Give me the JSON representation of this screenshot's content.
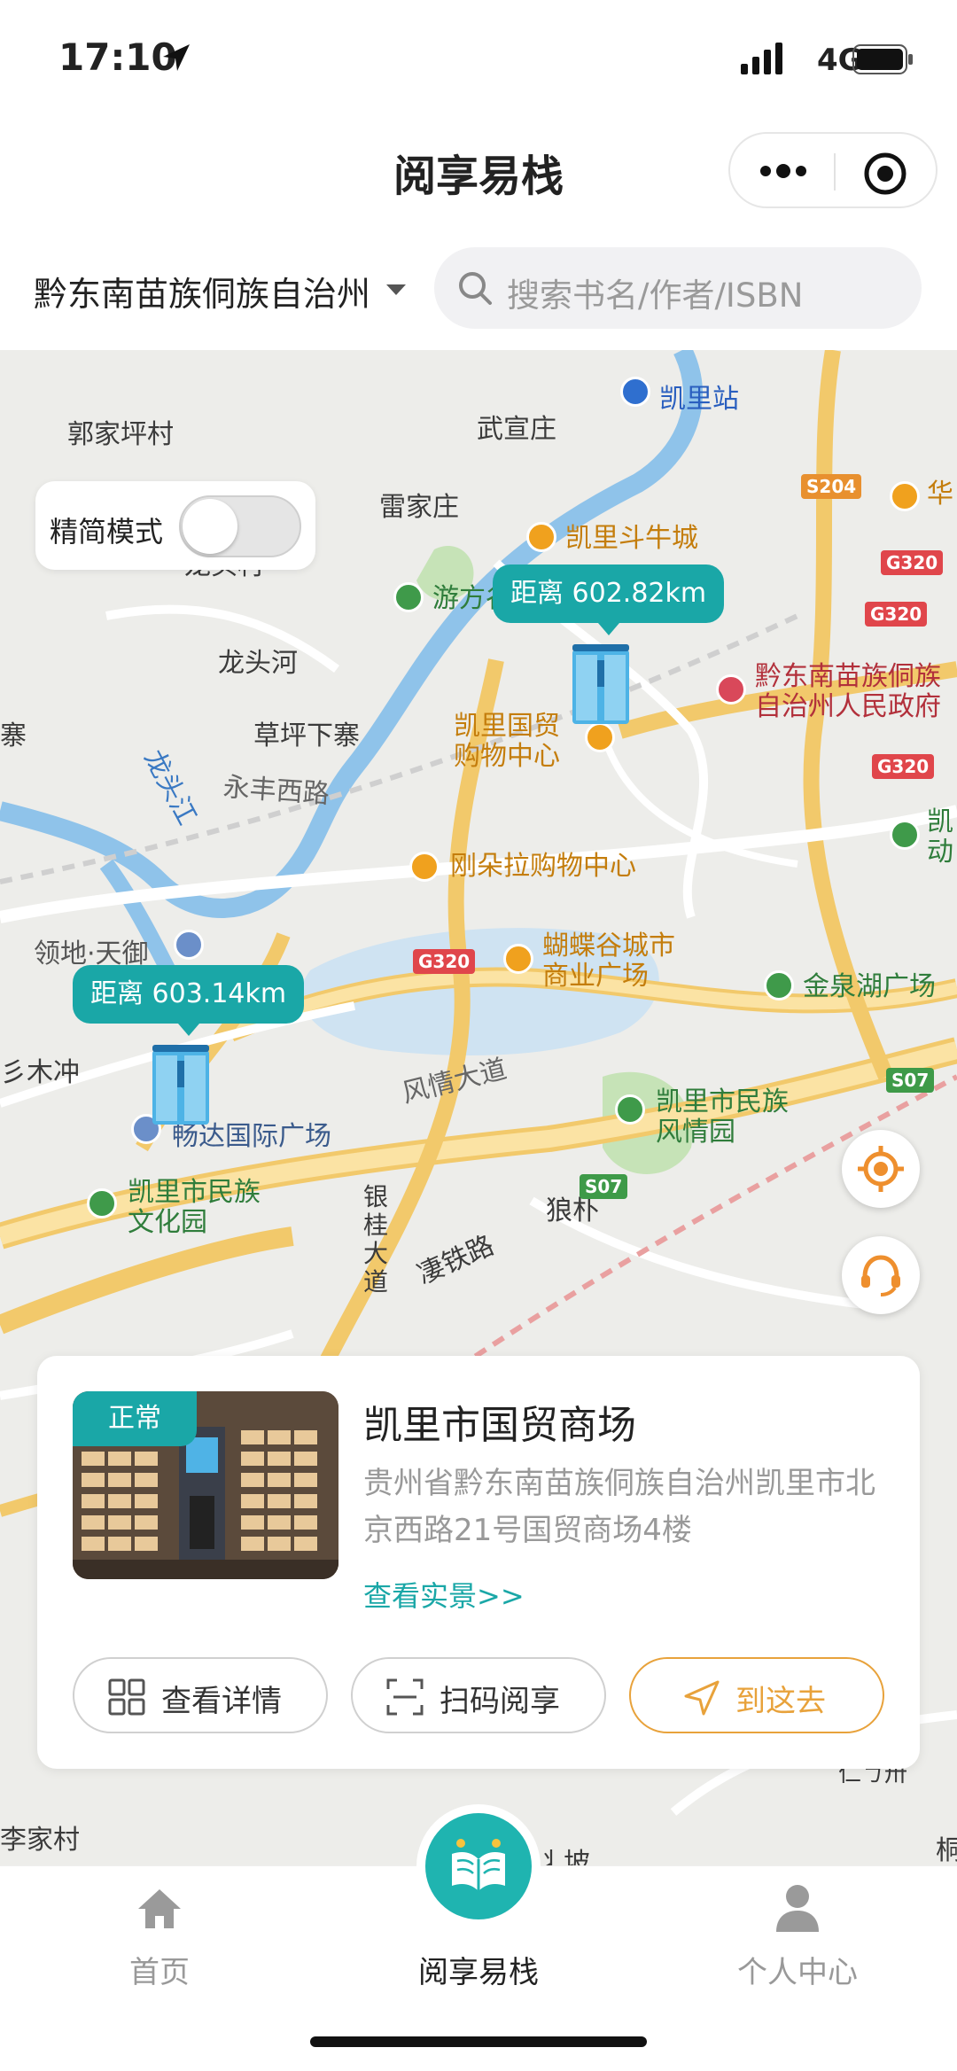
{
  "status_bar": {
    "time": "17:10",
    "network": "4G"
  },
  "navbar": {
    "title": "阅享易栈"
  },
  "search": {
    "region": "黔东南苗族侗族自治州",
    "placeholder": "搜索书名/作者/ISBN"
  },
  "map": {
    "simple_mode_label": "精简模式",
    "simple_mode_on": false,
    "markers": [
      {
        "distance": "距离 602.82km"
      },
      {
        "distance": "距离 603.14km"
      }
    ],
    "labels": {
      "guojiapingcun": "郭家坪村",
      "wuxuanzhuang": "武宣庄",
      "kailizhan": "凯里站",
      "leijiazhuang": "雷家庄",
      "hua": "华",
      "kailidouniucheng": "凯里斗牛城",
      "longtoucun": "龙头村",
      "youfanggu": "游方谷公园",
      "qiandongnan_gov": "黔东南苗族侗族\n自治州人民政府",
      "longtouhe": "龙头河",
      "kailiguomao": "凯里国贸\n购物中心",
      "caopingxiazhai": "草坪下寨",
      "zhai": "寨",
      "kai_dong": "凯\n动",
      "longtoujiang": "龙头江",
      "yongfengxilu": "永丰西路",
      "gangduola": "刚朵拉购物中心",
      "lingditianyu": "领地·天御",
      "hudiegu": "蝴蝶谷城市\n商业广场",
      "jinquanhu": "金泉湖广场",
      "shanmuchong": "彡木冲",
      "fengqingdadao": "风情大道",
      "kailiminzu_fengqing": "凯里市民族\n风情园",
      "changda": "畅达国际广场",
      "kailiminzu_wenhua": "凯里市民族\n文化园",
      "yinguidadao": "银\n桂\n大\n道",
      "langpu": "狼朴",
      "tielu": "凄铁路",
      "lijiacun": "李家村",
      "beiyijiu": "丬坡",
      "edge_r1": "仁ㄅ卅",
      "edge_r2": "桐"
    },
    "road_shields": [
      "S204",
      "G320",
      "G320",
      "G320",
      "G320",
      "S07",
      "S07"
    ]
  },
  "card": {
    "status": "正常",
    "title": "凯里市国贸商场",
    "address": "贵州省黔东南苗族侗族自治州凯里市北京西路21号国贸商场4楼",
    "link": "查看实景>>",
    "buttons": {
      "detail": "查看详情",
      "scan": "扫码阅享",
      "go": "到这去"
    }
  },
  "tabbar": {
    "home": "首页",
    "center": "阅享易栈",
    "profile": "个人中心"
  },
  "colors": {
    "accent": "#1aa7a7",
    "go": "#e8a23b"
  }
}
